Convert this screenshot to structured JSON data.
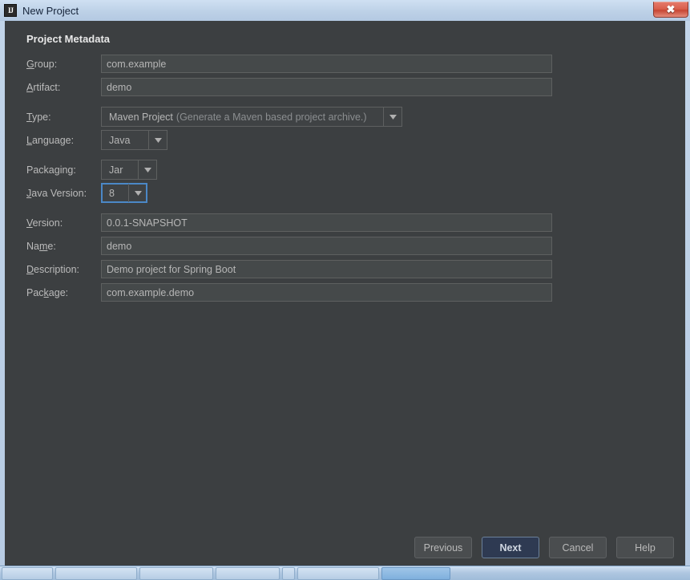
{
  "window": {
    "title": "New Project",
    "app_icon": "intellij-idea-icon",
    "app_icon_glyph": "IJ",
    "close_label": "✖",
    "frame_color": "#bdd0e6",
    "dialog_bg": "#3c3f41"
  },
  "dialog": {
    "section_title": "Project Metadata",
    "fields": [
      {
        "key": "group",
        "label_pre": "",
        "label_mnemonic": "G",
        "label_post": "roup:",
        "value": "com.example",
        "type": "text"
      },
      {
        "key": "artifact",
        "label_pre": "",
        "label_mnemonic": "A",
        "label_post": "rtifact:",
        "value": "demo",
        "type": "text"
      },
      {
        "key": "type",
        "label_pre": "",
        "label_mnemonic": "T",
        "label_post": "ype:",
        "value": "Maven Project",
        "value_hint": "(Generate a Maven based project archive.)",
        "type": "combo"
      },
      {
        "key": "language",
        "label_pre": "",
        "label_mnemonic": "L",
        "label_post": "anguage:",
        "value": "Java",
        "type": "combo"
      },
      {
        "key": "packaging",
        "label_pre": "Packa",
        "label_mnemonic": "g",
        "label_post": "ing:",
        "value": "Jar",
        "type": "combo"
      },
      {
        "key": "java_version",
        "label_pre": "",
        "label_mnemonic": "J",
        "label_post": "ava Version:",
        "value": "8",
        "type": "combo",
        "focused": true
      },
      {
        "key": "version",
        "label_pre": "",
        "label_mnemonic": "V",
        "label_post": "ersion:",
        "value": "0.0.1-SNAPSHOT",
        "type": "text"
      },
      {
        "key": "name",
        "label_pre": "Na",
        "label_mnemonic": "m",
        "label_post": "e:",
        "value": "demo",
        "type": "text"
      },
      {
        "key": "description",
        "label_pre": "",
        "label_mnemonic": "D",
        "label_post": "escription:",
        "value": "Demo project for Spring Boot",
        "type": "text"
      },
      {
        "key": "package",
        "label_pre": "Pac",
        "label_mnemonic": "k",
        "label_post": "age:",
        "value": "com.example.demo",
        "type": "text"
      }
    ]
  },
  "footer": {
    "previous_label": "Previous",
    "next_label": "Next",
    "cancel_label": "Cancel",
    "help_label": "Help",
    "default_button": "Next",
    "default_button_color": "#2e3a52"
  }
}
